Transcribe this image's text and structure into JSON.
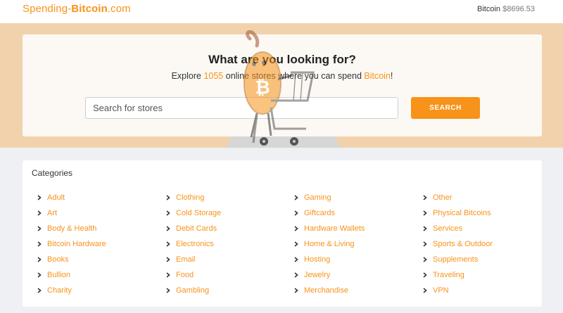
{
  "header": {
    "logo_part1": "Spending-",
    "logo_part2": "Bitcoin",
    "logo_part3": ".com",
    "price_label": "Bitcoin",
    "price_value": "$8696.53"
  },
  "hero": {
    "title": "What are you looking for?",
    "subtitle_pre": "Explore ",
    "store_count": "1055",
    "subtitle_mid": " online stores where you can spend ",
    "subtitle_link": "Bitcoin",
    "subtitle_post": "!",
    "search_placeholder": "Search for stores",
    "search_button": "SEARCH"
  },
  "categories": {
    "title": "Categories",
    "columns": [
      [
        "Adult",
        "Art",
        "Body & Health",
        "Bitcoin Hardware",
        "Books",
        "Bullion",
        "Charity"
      ],
      [
        "Clothing",
        "Cold Storage",
        "Debit Cards",
        "Electronics",
        "Email",
        "Food",
        "Gambling"
      ],
      [
        "Gaming",
        "Giftcards",
        "Hardware Wallets",
        "Home & Living",
        "Hosting",
        "Jewelry",
        "Merchandise"
      ],
      [
        "Other",
        "Physical Bitcoins",
        "Services",
        "Sports & Outdoor",
        "Supplements",
        "Traveling",
        "VPN"
      ]
    ]
  },
  "colors": {
    "accent": "#f7931a",
    "hero_bg": "#f2d2ad",
    "page_bg": "#eef0f4"
  }
}
